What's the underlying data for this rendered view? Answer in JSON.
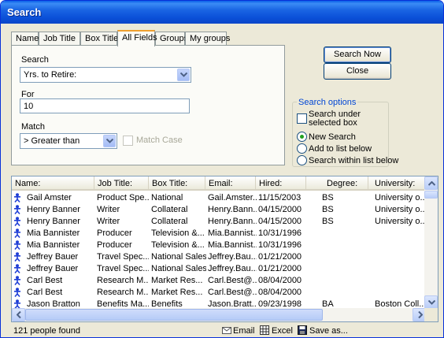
{
  "window": {
    "title": "Search"
  },
  "tabs": [
    "Name",
    "Job Title",
    "Box Title",
    "All Fields",
    "Groups",
    "My groups"
  ],
  "active_tab": "All Fields",
  "form": {
    "search_label": "Search",
    "search_value": "Yrs. to Retire:",
    "for_label": "For",
    "for_value": "10",
    "match_label": "Match",
    "match_value": "> Greater than",
    "match_case_label": "Match Case"
  },
  "buttons": {
    "search_now": "Search Now",
    "close": "Close"
  },
  "options": {
    "title": "Search options",
    "search_under": "Search under selected box",
    "radios": [
      "New Search",
      "Add to list below",
      "Search within list below"
    ],
    "selected_radio": 0
  },
  "list": {
    "columns": [
      "Name:",
      "Job Title:",
      "Box Title:",
      "Email:",
      "Hired:",
      "Degree:",
      "University:"
    ],
    "rows": [
      [
        "Gail Amster",
        "Product Spe...",
        "National",
        "Gail.Amster...",
        "11/15/2003",
        "BS",
        "University o..."
      ],
      [
        "Henry Banner",
        "Writer",
        "Collateral",
        "Henry.Bann...",
        "04/15/2000",
        "BS",
        "University o..."
      ],
      [
        "Henry Banner",
        "Writer",
        "Collateral",
        "Henry.Bann...",
        "04/15/2000",
        "BS",
        "University o..."
      ],
      [
        "Mia Bannister",
        "Producer",
        "Television &...",
        "Mia.Bannist...",
        "10/31/1996",
        "",
        ""
      ],
      [
        "Mia Bannister",
        "Producer",
        "Television &...",
        "Mia.Bannist...",
        "10/31/1996",
        "",
        ""
      ],
      [
        "Jeffrey Bauer",
        "Travel Spec...",
        "National Sales",
        "Jeffrey.Bau...",
        "01/21/2000",
        "",
        ""
      ],
      [
        "Jeffrey Bauer",
        "Travel Spec...",
        "National Sales",
        "Jeffrey.Bau...",
        "01/21/2000",
        "",
        ""
      ],
      [
        "Carl Best",
        "Research M...",
        "Market Res...",
        "Carl.Best@...",
        "08/04/2000",
        "",
        ""
      ],
      [
        "Carl Best",
        "Research M...",
        "Market Res...",
        "Carl.Best@...",
        "08/04/2000",
        "",
        ""
      ],
      [
        "Jason Bratton",
        "Benefits Ma...",
        "Benefits",
        "Jason.Bratt...",
        "09/23/1998",
        "BA",
        "Boston Coll..."
      ]
    ]
  },
  "status": {
    "found_text": "121 people found",
    "email": "Email",
    "excel": "Excel",
    "save_as": "Save as..."
  },
  "colors": {
    "title_bar": "#0a4fd8",
    "window_bg": "#ece9d8",
    "person_icon": "#1f3fd6"
  }
}
